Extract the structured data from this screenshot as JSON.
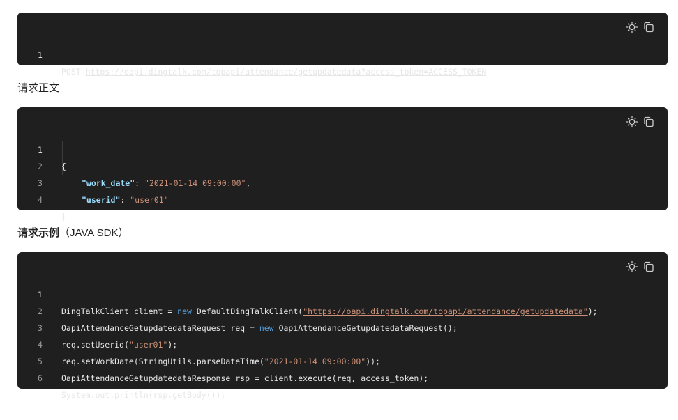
{
  "blocks": [
    {
      "lines": [
        {
          "num": "1",
          "prefix": "POST ",
          "url": "https://oapi.dingtalk.com/topapi/attendance/getupdatedata?access_token=ACCESS_TOKEN"
        }
      ]
    }
  ],
  "heading1": "请求正文",
  "body_block": {
    "lines": [
      {
        "num": "1",
        "text": "{"
      },
      {
        "num": "2",
        "key": "\"work_date\"",
        "sep": ": ",
        "value": "\"2021-01-14 09:00:00\"",
        "tail": ","
      },
      {
        "num": "3",
        "key": "\"userid\"",
        "sep": ": ",
        "value": "\"user01\"",
        "tail": ""
      },
      {
        "num": "4",
        "text": "}"
      }
    ]
  },
  "heading2": {
    "main": "请求示例",
    "sub": "（JAVA SDK）"
  },
  "sdk_block": {
    "line1": {
      "num": "1",
      "a": "DingTalkClient client = ",
      "kw": "new",
      "b": " DefaultDingTalkClient(",
      "url": "\"https://oapi.dingtalk.com/topapi/attendance/getupdatedata\"",
      "c": ");"
    },
    "line2": {
      "num": "2",
      "a": "OapiAttendanceGetupdatedataRequest req = ",
      "kw": "new",
      "b": " OapiAttendanceGetupdatedataRequest();"
    },
    "line3": {
      "num": "3",
      "a": "req.setUserid(",
      "str": "\"user01\"",
      "b": ");"
    },
    "line4": {
      "num": "4",
      "a": "req.setWorkDate(StringUtils.parseDateTime(",
      "str": "\"2021-01-14 09:00:00\"",
      "b": "));"
    },
    "line5": {
      "num": "5",
      "a": "OapiAttendanceGetupdatedataResponse rsp = client.execute(req, access_token);"
    },
    "line6": {
      "num": "6",
      "a": "System.out.println(rsp.getBody());"
    }
  },
  "icons": {
    "theme": "sun-icon",
    "copy": "copy-icon"
  }
}
